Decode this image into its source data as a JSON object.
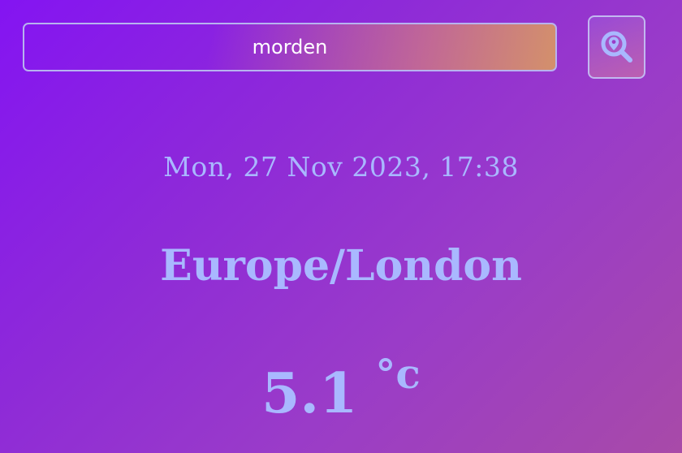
{
  "search": {
    "value": "morden",
    "button_icon": "location-search-icon"
  },
  "weather": {
    "datetime": "Mon, 27 Nov 2023, 17:38",
    "location": "Europe/London",
    "temperature": "5.1",
    "unit": "°c"
  },
  "colors": {
    "text_accent": "#a9b8ff",
    "background_start": "#8414f2",
    "background_end": "#a84aa8"
  }
}
